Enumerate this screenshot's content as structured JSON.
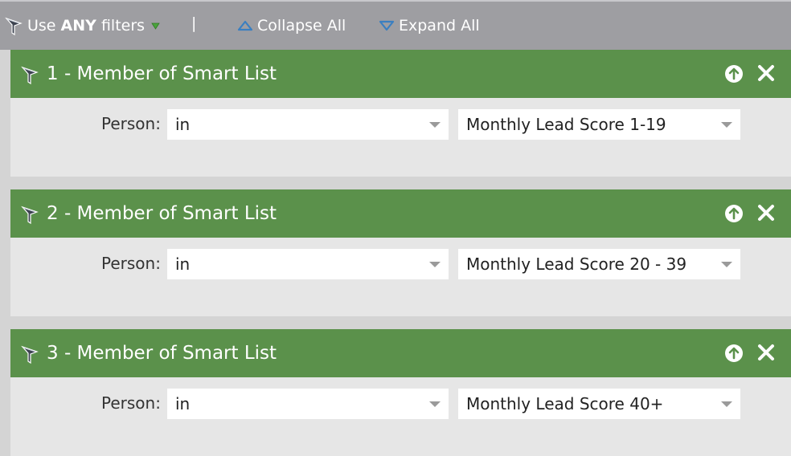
{
  "toolbar": {
    "filter_prefix": "Use",
    "filter_mode": "ANY",
    "filter_suffix": "filters",
    "separator": "|",
    "collapse_label": "Collapse All",
    "expand_label": "Expand All"
  },
  "filters": [
    {
      "title": "1 - Member of Smart List",
      "field_label": "Person:",
      "operator": "in",
      "value": "Monthly Lead Score 1-19"
    },
    {
      "title": "2 - Member of Smart List",
      "field_label": "Person:",
      "operator": "in",
      "value": "Monthly Lead Score 20 - 39"
    },
    {
      "title": "3 - Member of Smart List",
      "field_label": "Person:",
      "operator": "in",
      "value": "Monthly Lead Score 40+"
    }
  ],
  "icons": {
    "filter": "funnel-icon",
    "caret": "caret-down-icon",
    "collapse": "triangle-up-icon",
    "expand": "triangle-down-icon",
    "move_up": "arrow-up-circle-icon",
    "remove": "close-icon",
    "dropdown": "chevron-down-icon"
  },
  "colors": {
    "toolbar_bg": "#9e9ea2",
    "panel_header": "#5b914b",
    "panel_body": "#e6e6e6",
    "caret_green": "#4aa33c",
    "triangle_blue": "#3a7fc1"
  }
}
